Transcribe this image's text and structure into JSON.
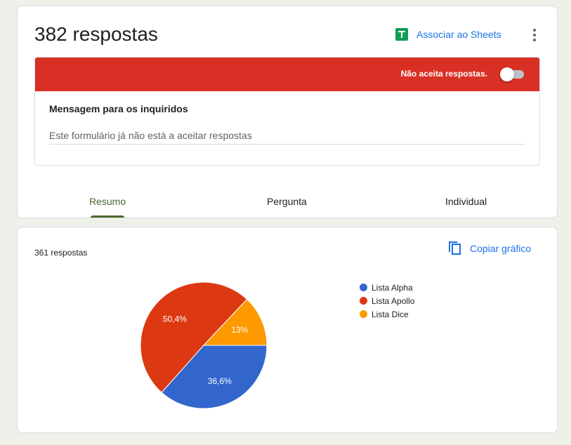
{
  "header": {
    "title": "382 respostas",
    "sheets_label": "Associar ao Sheets"
  },
  "banner": {
    "text": "Não aceita respostas.",
    "accepting": false,
    "color": "#d93025"
  },
  "message": {
    "label": "Mensagem para os inquiridos",
    "value": "Este formulário já não está a aceitar respostas"
  },
  "tabs": [
    {
      "label": "Resumo",
      "active": true
    },
    {
      "label": "Pergunta",
      "active": false
    },
    {
      "label": "Individual",
      "active": false
    }
  ],
  "summary": {
    "count_label": "361 respostas",
    "copy_label": "Copiar gráfico"
  },
  "chart_data": {
    "type": "pie",
    "categories": [
      "Lista Alpha",
      "Lista Apollo",
      "Lista Dice"
    ],
    "values": [
      36.6,
      50.4,
      13
    ],
    "labels": [
      "36,6%",
      "50,4%",
      "13%"
    ],
    "colors": [
      "#3366cc",
      "#dc3912",
      "#ff9900"
    ],
    "legend_position": "right"
  }
}
